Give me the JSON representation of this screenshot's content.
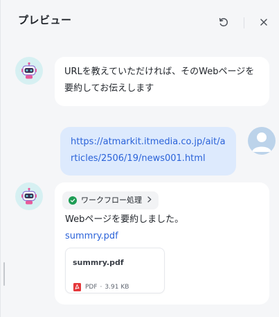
{
  "header": {
    "title": "プレビュー",
    "refresh_icon": "refresh-icon",
    "close_icon": "close-icon"
  },
  "messages": {
    "bot_intro": "URLを教えていただければ、そのWebページを要約してお伝えします",
    "user_url": "https://atmarkit.itmedia.co.jp/ait/articles/2506/19/news001.html",
    "workflow_label": "ワークフロー処理",
    "summary_done": "Webページを要約しました。",
    "file_link": "summry.pdf",
    "file_card": {
      "name": "summry.pdf",
      "type": "PDF",
      "separator": "·",
      "size": "3.91 KB"
    }
  },
  "colors": {
    "accent": "#2b63d9",
    "user_bubble": "#ddeafd",
    "success": "#1f9d55",
    "pdf_red": "#e5383b"
  }
}
